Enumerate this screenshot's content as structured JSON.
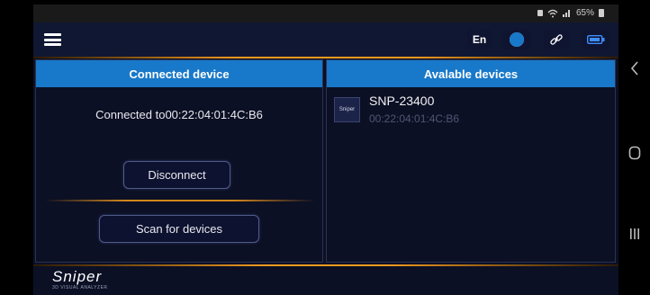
{
  "status_bar": {
    "signal_text": "65%"
  },
  "topbar": {
    "language": "En"
  },
  "connected_panel": {
    "title": "Connected device",
    "status_text": "Connected to00:22:04:01:4C:B6",
    "disconnect_label": "Disconnect",
    "scan_label": "Scan for devices"
  },
  "available_panel": {
    "title": "Avalable devices",
    "devices": [
      {
        "thumb_text": "Sniper",
        "name": "SNP-23400",
        "address": "00:22:04:01:4C:B6"
      }
    ]
  },
  "footer": {
    "logo_text": "Sniper",
    "logo_subtitle": "3D VISUAL ANALYZER"
  },
  "colors": {
    "accent": "#f39b1f",
    "header_blue": "#1878c9",
    "background": "#0b1025"
  }
}
